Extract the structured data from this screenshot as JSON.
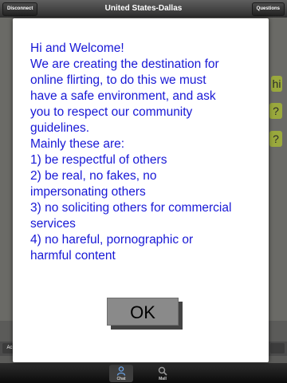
{
  "navbar": {
    "left_button": "Disconnect",
    "title": "United States-Dallas",
    "right_button": "Questions"
  },
  "background": {
    "bubbles": [
      "hi",
      "?",
      "?"
    ],
    "left_button": "Ac"
  },
  "modal": {
    "lines": [
      "Hi and Welcome!",
      "We are creating the destination for",
      "online flirting, to do this we must",
      "have a safe environment, and ask",
      "you to respect our community",
      "guidelines.",
      "Mainly these are:",
      "1) be respectful of others",
      "2) be real, no fakes, no",
      "impersonating others",
      "3) no soliciting others for commercial",
      "services",
      "4) no hareful, pornographic or",
      "harmful content"
    ],
    "ok_label": "OK"
  },
  "tabs": [
    {
      "label": "Chat",
      "icon": "person-icon",
      "active": true
    },
    {
      "label": "Mall",
      "icon": "search-icon",
      "active": false
    }
  ],
  "colors": {
    "modal_text": "#1818d6",
    "bubble": "#9aa93d"
  }
}
